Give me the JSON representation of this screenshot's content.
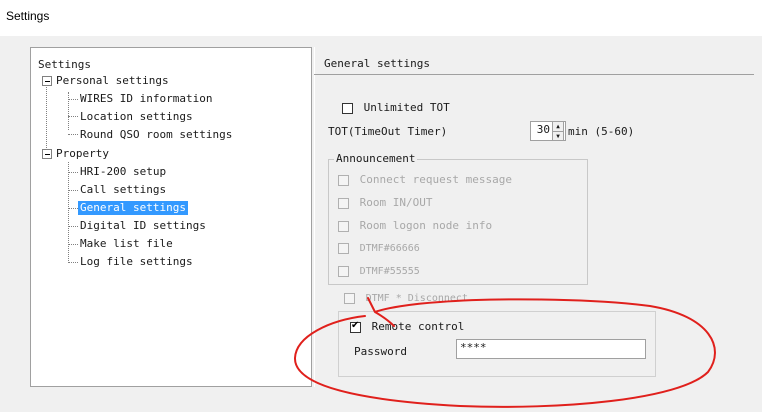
{
  "window": {
    "title": "Settings"
  },
  "tree": {
    "root": "Settings",
    "personal": {
      "label": "Personal settings",
      "children": [
        "WIRES ID information",
        "Location settings",
        "Round QSO room settings"
      ]
    },
    "property": {
      "label": "Property",
      "children": [
        "HRI-200 setup",
        "Call settings",
        "General settings",
        "Digital ID settings",
        "Make list file",
        "Log file settings"
      ]
    },
    "selected": "General settings"
  },
  "general": {
    "header": "General settings",
    "unlimited_tot_label": "Unlimited TOT",
    "unlimited_tot_checked": false,
    "tot_label": "TOT(TimeOut Timer)",
    "tot_value": "30",
    "tot_unit": "min (5-60)",
    "announcement": {
      "title": "Announcement",
      "items": [
        {
          "label": "Connect request message",
          "checked": false,
          "enabled": false
        },
        {
          "label": "Room IN/OUT",
          "checked": false,
          "enabled": false
        },
        {
          "label": "Room logon node info",
          "checked": false,
          "enabled": false
        },
        {
          "label": "DTMF#66666",
          "checked": false,
          "enabled": false
        },
        {
          "label": "DTMF#55555",
          "checked": false,
          "enabled": false
        }
      ]
    },
    "dtmf_disconnect_label": "DTMF * Disconnect",
    "remote_control_label": "Remote control",
    "remote_control_checked": true,
    "password_label": "Password",
    "password_value": "****"
  },
  "colors": {
    "selection": "#3399ff",
    "annotation": "#e0201c",
    "panel_bg": "#f0f0f0"
  }
}
